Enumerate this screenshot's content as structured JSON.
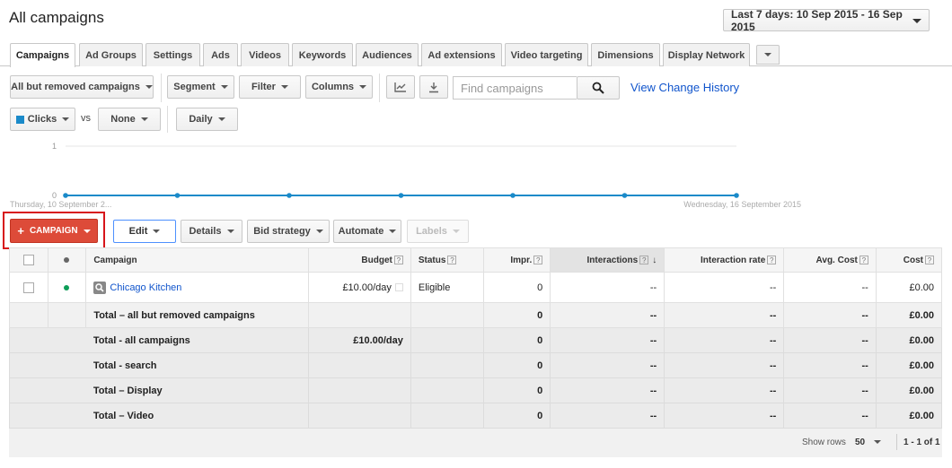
{
  "header": {
    "title": "All campaigns",
    "date_range": "Last 7 days: 10 Sep 2015 - 16 Sep 2015"
  },
  "tabs": [
    {
      "label": "Campaigns",
      "active": true
    },
    {
      "label": "Ad Groups"
    },
    {
      "label": "Settings"
    },
    {
      "label": "Ads"
    },
    {
      "label": "Videos"
    },
    {
      "label": "Keywords"
    },
    {
      "label": "Audiences"
    },
    {
      "label": "Ad extensions"
    },
    {
      "label": "Video targeting"
    },
    {
      "label": "Dimensions"
    },
    {
      "label": "Display Network"
    }
  ],
  "toolbar": {
    "filter_view": "All but removed campaigns",
    "segment": "Segment",
    "filter": "Filter",
    "columns": "Columns",
    "search_placeholder": "Find campaigns",
    "view_history": "View Change History"
  },
  "metrics": {
    "primary": "Clicks",
    "vs": "vs",
    "secondary": "None",
    "period": "Daily"
  },
  "chart_data": {
    "type": "line",
    "y_ticks": [
      "1",
      "0"
    ],
    "ylim": [
      0,
      1
    ],
    "start_label": "Thursday, 10 September 2...",
    "end_label": "Wednesday, 16 September 2015",
    "series": [
      {
        "name": "Clicks",
        "values": [
          0,
          0,
          0,
          0,
          0,
          0,
          0
        ]
      }
    ],
    "color": "#1a8ac9"
  },
  "actions": {
    "campaign": "CAMPAIGN",
    "edit": "Edit",
    "details": "Details",
    "bid_strategy": "Bid strategy",
    "automate": "Automate",
    "labels": "Labels"
  },
  "table": {
    "headers": {
      "campaign": "Campaign",
      "budget": "Budget",
      "status": "Status",
      "impr": "Impr.",
      "interactions": "Interactions",
      "interaction_rate": "Interaction rate",
      "avg_cost": "Avg. Cost",
      "cost": "Cost"
    },
    "row": {
      "campaign": "Chicago Kitchen",
      "budget": "£10.00/day",
      "status": "Eligible",
      "impr": "0",
      "interactions": "--",
      "interaction_rate": "--",
      "avg_cost": "--",
      "cost": "£0.00"
    },
    "totals": [
      {
        "label": "Total – all but removed campaigns",
        "budget": "",
        "impr": "0",
        "interactions": "--",
        "interaction_rate": "--",
        "avg_cost": "--",
        "cost": "£0.00"
      },
      {
        "label": "Total - all campaigns",
        "budget": "£10.00/day",
        "impr": "0",
        "interactions": "--",
        "interaction_rate": "--",
        "avg_cost": "--",
        "cost": "£0.00"
      },
      {
        "label": "Total - search",
        "budget": "",
        "impr": "0",
        "interactions": "--",
        "interaction_rate": "--",
        "avg_cost": "--",
        "cost": "£0.00"
      },
      {
        "label": "Total – Display",
        "budget": "",
        "impr": "0",
        "interactions": "--",
        "interaction_rate": "--",
        "avg_cost": "--",
        "cost": "£0.00"
      },
      {
        "label": "Total – Video",
        "budget": "",
        "impr": "0",
        "interactions": "--",
        "interaction_rate": "--",
        "avg_cost": "--",
        "cost": "£0.00"
      }
    ]
  },
  "footer": {
    "show_rows_label": "Show rows",
    "rows_value": "50",
    "range": "1 - 1 of 1"
  },
  "colors": {
    "accent": "#dd4b39",
    "link": "#1155cc",
    "chart": "#1a8ac9",
    "highlight": "#d7141a"
  }
}
